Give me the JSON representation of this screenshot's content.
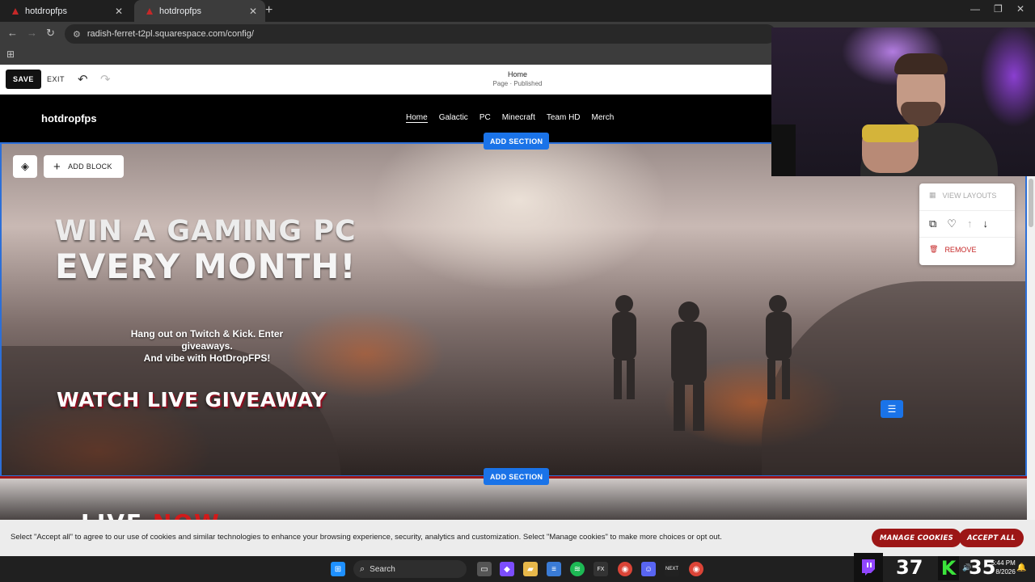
{
  "browser": {
    "tabs": [
      {
        "label": "hotdropfps",
        "close": "✕"
      },
      {
        "label": "hotdropfps",
        "close": "✕"
      }
    ],
    "new_tab": "+",
    "url": "radish-ferret-t2pl.squarespace.com/config/",
    "controls": {
      "back": "←",
      "forward": "→",
      "reload": "↻",
      "minimize": "—",
      "maximize": "❐",
      "close": "✕"
    }
  },
  "editor": {
    "save_label": "SAVE",
    "exit_label": "EXIT",
    "page_title": "Home",
    "page_status": "Page · Published"
  },
  "site": {
    "logo": "hotdropfps",
    "nav": [
      "Home",
      "Galactic",
      "PC",
      "Minecraft",
      "Team HD",
      "Merch"
    ]
  },
  "hero": {
    "add_block_label": "ADD BLOCK",
    "headline_1": "WIN A GAMING PC",
    "headline_2": "EVERY MONTH!",
    "subtext_lines": [
      "Hang out on Twitch & Kick. Enter",
      "giveaways.",
      "And vibe with HotDropFPS!"
    ],
    "cta_1": "WATCH LIVE",
    "cta_2": "GIVEAWAY"
  },
  "add_section_label": "ADD SECTION",
  "section_panel": {
    "view_layouts": "VIEW LAYOUTS",
    "remove": "REMOVE"
  },
  "section2": {
    "word_1": "LIVE",
    "word_2": "NOW"
  },
  "cookie": {
    "text": "Select \"Accept all\" to agree to our use of cookies and similar technologies to enhance your browsing experience, security, analytics and customization. Select \"Manage cookies\" to make more choices or opt out.",
    "manage_label": "MANAGE COOKIES",
    "accept_label": "ACCEPT ALL"
  },
  "taskbar": {
    "search_label": "Search",
    "twitch_count": "37",
    "kick_count": "35",
    "kick_letter": "K",
    "time": "5:44 PM",
    "date": "8/2026"
  },
  "colors": {
    "accent_blue": "#1a73e8",
    "brand_red": "#9c1616",
    "kick_green": "#3be33b",
    "twitch_purple": "#9146ff"
  }
}
